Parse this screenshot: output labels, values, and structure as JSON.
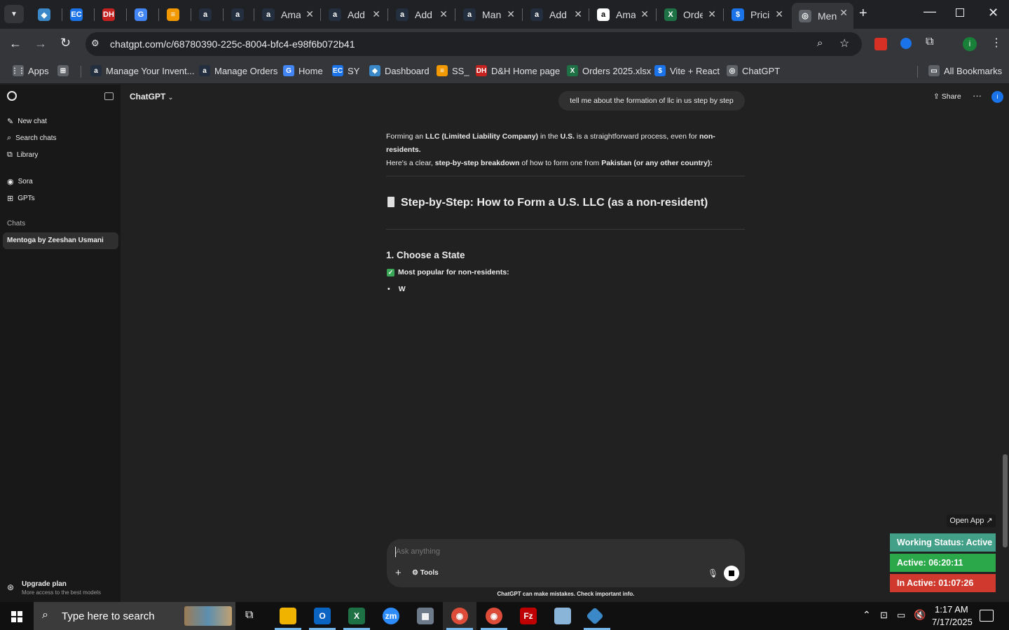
{
  "tabs": [
    {
      "label": "",
      "favicon": "diamond-icon",
      "color": "#3a88c8"
    },
    {
      "label": "",
      "favicon": "ec-icon",
      "color": "#1a73e8"
    },
    {
      "label": "",
      "favicon": "dh-icon",
      "color": "#c5221f"
    },
    {
      "label": "",
      "favicon": "google-sites-icon",
      "color": "#4285f4"
    },
    {
      "label": "",
      "favicon": "stack-icon",
      "color": "#f29900"
    },
    {
      "label": "",
      "favicon": "amazon-icon",
      "color": "#232f3e"
    },
    {
      "label": "",
      "favicon": "amazon-icon",
      "color": "#232f3e"
    },
    {
      "label": "Ama",
      "favicon": "amazon-icon",
      "color": "#232f3e"
    },
    {
      "label": "Add",
      "favicon": "amazon-icon",
      "color": "#232f3e"
    },
    {
      "label": "Add",
      "favicon": "amazon-icon",
      "color": "#232f3e"
    },
    {
      "label": "Man",
      "favicon": "amazon-icon",
      "color": "#232f3e"
    },
    {
      "label": "Add",
      "favicon": "amazon-icon",
      "color": "#232f3e"
    },
    {
      "label": "Ama",
      "favicon": "amazon-icon",
      "color": "#ffffff"
    },
    {
      "label": "Orde",
      "favicon": "excel-icon",
      "color": "#1e7145"
    },
    {
      "label": "Prici",
      "favicon": "dollar-icon",
      "color": "#1a73e8"
    },
    {
      "label": "Men",
      "favicon": "chatgpt-icon",
      "color": "#5f6368"
    }
  ],
  "address_bar": {
    "url": "chatgpt.com/c/68780390-225c-8004-bfc4-e98f6b072b41"
  },
  "bookmarks": [
    {
      "label": "Apps",
      "icon": "apps-grid-icon",
      "color": "#5f6368"
    },
    {
      "label": "",
      "icon": "tab-groups-icon",
      "color": "#5f6368"
    },
    {
      "label": "Manage Your Invent...",
      "icon": "amazon-icon",
      "color": "#232f3e"
    },
    {
      "label": "Manage Orders",
      "icon": "amazon-icon",
      "color": "#232f3e"
    },
    {
      "label": "Home",
      "icon": "google-sites-icon",
      "color": "#4285f4"
    },
    {
      "label": "SY",
      "icon": "ec-icon",
      "color": "#1a73e8"
    },
    {
      "label": "Dashboard",
      "icon": "diamond-icon",
      "color": "#3a88c8"
    },
    {
      "label": "SS_",
      "icon": "stack-icon",
      "color": "#f29900"
    },
    {
      "label": "D&H Home page",
      "icon": "dh-icon",
      "color": "#c5221f"
    },
    {
      "label": "Orders 2025.xlsx",
      "icon": "excel-icon",
      "color": "#1e7145"
    },
    {
      "label": "Vite + React",
      "icon": "dollar-icon",
      "color": "#1a73e8"
    },
    {
      "label": "ChatGPT",
      "icon": "chatgpt-icon",
      "color": "#5f6368"
    },
    {
      "label": "All Bookmarks",
      "icon": "folder-icon",
      "color": "#5f6368"
    }
  ],
  "sidebar": {
    "new_chat": "New chat",
    "search_chats": "Search chats",
    "library": "Library",
    "sora": "Sora",
    "gpts": "GPTs",
    "chats_heading": "Chats",
    "active_chat": "Mentoga by Zeeshan Usmani",
    "upgrade_title": "Upgrade plan",
    "upgrade_sub": "More access to the best models"
  },
  "header": {
    "model": "ChatGPT",
    "share": "Share"
  },
  "conversation": {
    "user_message": "tell me about the formation of llc in us step by step",
    "intro_1": "Forming an",
    "intro_b1": "LLC (Limited Liability Company)",
    "intro_2": "in the",
    "intro_b2": "U.S.",
    "intro_3": "is a straightforward process, even for",
    "intro_b3": "non-residents.",
    "intro_4": "Here's a clear,",
    "intro_b4": "step-by-step breakdown",
    "intro_5": "of how to form one from",
    "intro_b5": "Pakistan (or any other country):",
    "heading": "Step-by-Step: How to Form a U.S. LLC (as a non-resident)",
    "step1_title": "1. Choose a State",
    "step1_sub": "Most popular for non-residents:",
    "bullet_partial": "W"
  },
  "composer": {
    "placeholder": "Ask anything",
    "tools": "Tools"
  },
  "disclaimer": "ChatGPT can make mistakes. Check important info.",
  "tracker": {
    "open_app": "Open App ↗",
    "working_status": "Working Status: Active",
    "active": "Active: 06:20:11",
    "inactive": "In Active: 01:07:26",
    "colors": {
      "working": "#42a088",
      "active": "#2aa84a",
      "inactive": "#d03a2e"
    }
  },
  "taskbar": {
    "search_placeholder": "Type here to search",
    "time": "1:17 AM",
    "date": "7/17/2025"
  }
}
